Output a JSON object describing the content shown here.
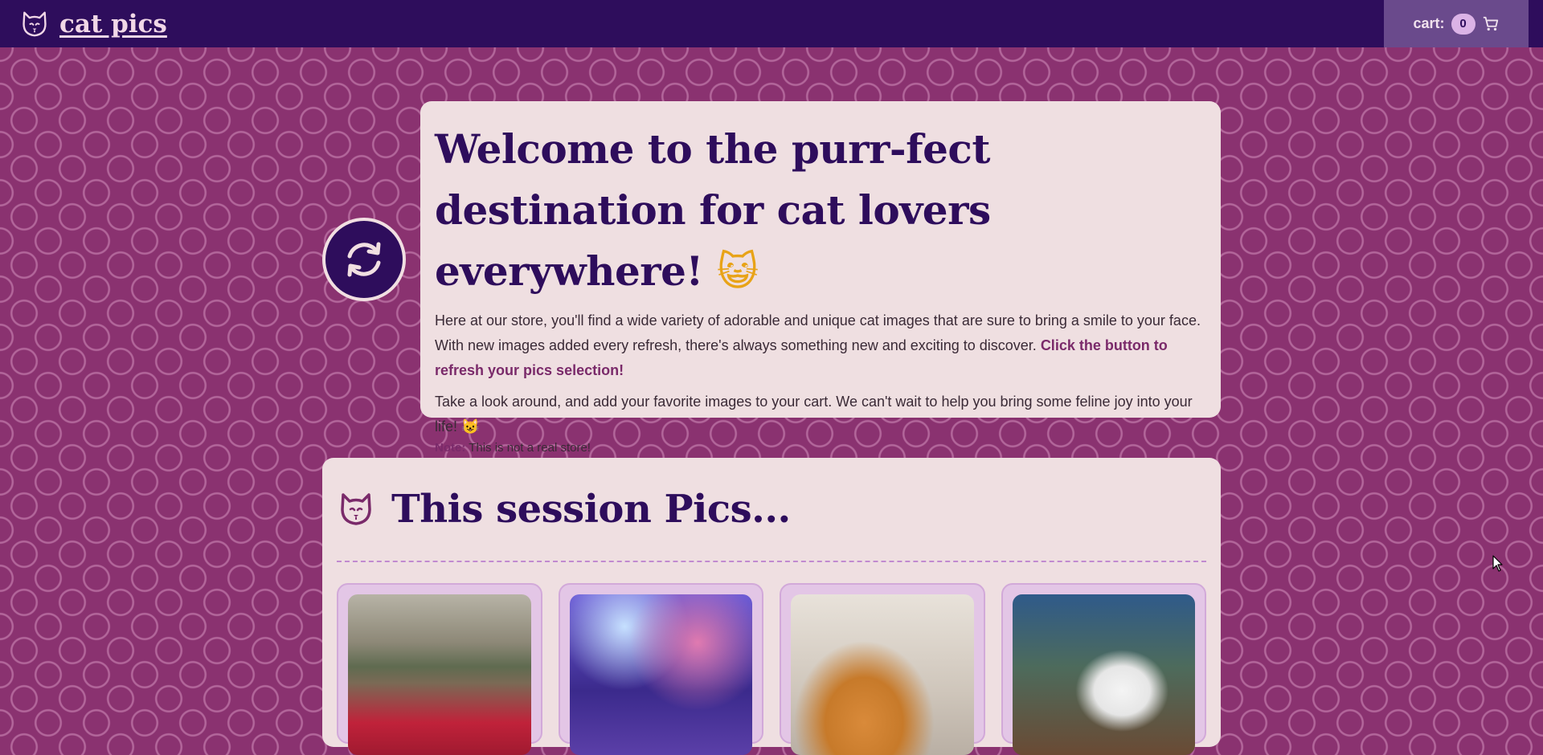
{
  "header": {
    "brand": "cat pics",
    "cart_label": "cart:",
    "cart_count": "0"
  },
  "welcome": {
    "title": "Welcome to the purr-fect destination for cat lovers everywhere!",
    "title_emoji": "😺",
    "p1_text": "Here at our store, you'll find a wide variety of adorable and unique cat images that are sure to bring a smile to your face. With new images added every refresh, there's always something new and exciting to discover. ",
    "p1_cta": "Click the button to refresh your pics selection!",
    "p2_text": "Take a look around, and add your favorite images to your cart. We can't wait to help you bring some feline joy into your life! ",
    "p2_emoji": "😺",
    "note_label": "Note:",
    "note_text": " This is not a real store!"
  },
  "session": {
    "title": "This session Pics..."
  },
  "icons": {
    "logo": "cat-face-icon",
    "cart": "shopping-cart-icon",
    "refresh": "refresh-arrows-icon",
    "session": "cat-face-icon"
  },
  "colors": {
    "topbar": "#2e0d5c",
    "background": "#8a3270",
    "card": "#efdfe1",
    "accent": "#7a2a6a"
  }
}
